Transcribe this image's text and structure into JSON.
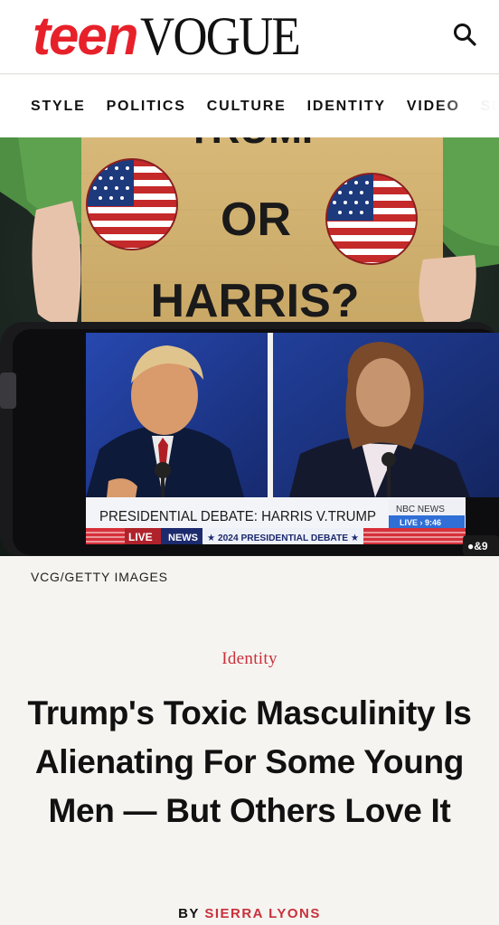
{
  "header": {
    "logo_part1": "teen",
    "logo_part2": "VOGUE",
    "search_icon": "search-icon"
  },
  "nav": {
    "items": [
      {
        "label": "STYLE"
      },
      {
        "label": "POLITICS"
      },
      {
        "label": "CULTURE"
      },
      {
        "label": "IDENTITY"
      },
      {
        "label": "VIDEO"
      },
      {
        "label": "SL"
      }
    ]
  },
  "hero": {
    "sign_line1": "TRUMP",
    "sign_line2": "OR",
    "sign_line3": "HARRIS?",
    "chyron_title": "PRESIDENTIAL DEBATE: HARRIS V.TRUMP",
    "network": "NBC NEWS",
    "live_time": "LIVE › 9:46",
    "ticker_live": "LIVE",
    "ticker_network": "NEWS",
    "ticker_event": "★ 2024 PRESIDENTIAL DEBATE ★",
    "phone_corner": "●&9",
    "colors": {
      "accent_red": "#c8313b",
      "brand_red": "#e7212a",
      "studio_blue": "#1c3a8c"
    }
  },
  "credit": "VCG/GETTY IMAGES",
  "article": {
    "rubric": "Identity",
    "headline": "Trump's Toxic Masculinity Is Alienating For Some Young Men — But Others Love It",
    "byline_prefix": "BY ",
    "author": "SIERRA LYONS"
  }
}
